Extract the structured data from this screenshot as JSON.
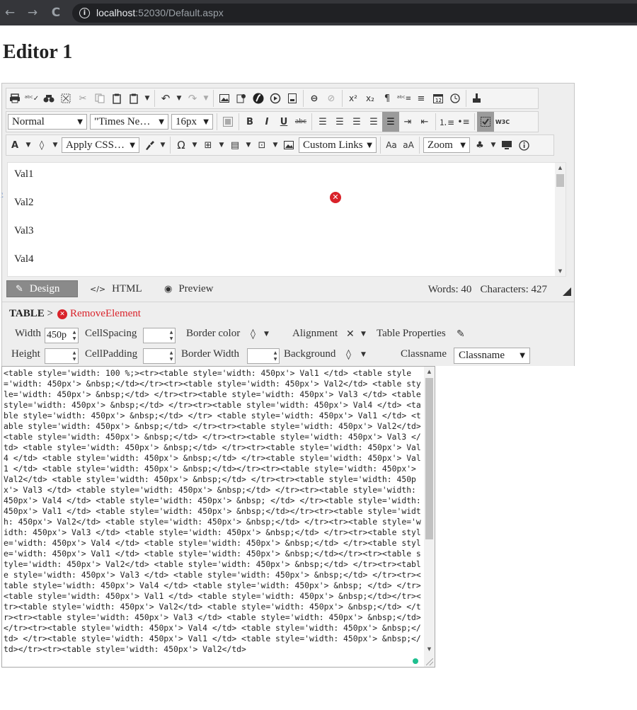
{
  "browser": {
    "back_icon": "←",
    "forward_icon": "→",
    "reload_icon": "C",
    "url_host": "localhost",
    "url_rest": ":52030/Default.aspx"
  },
  "page": {
    "title": "Editor 1"
  },
  "toolbar": {
    "row1": [
      "print-icon",
      "spellcheck-icon",
      "find-icon",
      "select-all-icon",
      "cut-icon",
      "copy-icon",
      "paste-icon",
      "paste-special-icon",
      "undo-icon",
      "redo-icon",
      "insert-image-icon",
      "insert-document-icon",
      "insert-flash-icon",
      "insert-media-icon",
      "insert-template-icon",
      "link-icon",
      "unlink-icon",
      "superscript-icon",
      "subscript-icon",
      "paragraph-icon",
      "special-chars-icon",
      "justify-icon",
      "date-icon",
      "time-icon",
      "format-painter-icon"
    ],
    "superscript_label": "x²",
    "subscript_label": "x₂",
    "paragraph_label": "¶",
    "format_block": "Normal",
    "font_name": "\"Times Ne…",
    "font_size": "16px",
    "bold": "B",
    "italic": "I",
    "underline": "U",
    "strike": "abc",
    "w3c_label": "W3C",
    "forecolor": "A",
    "apply_css": "Apply CSS…",
    "omega": "Ω",
    "custom_links": "Custom Links",
    "case_upper": "Aa",
    "case_lower": "aA",
    "zoom": "Zoom"
  },
  "content": {
    "rows": [
      "Val1",
      "Val2",
      "Val3",
      "Val4"
    ]
  },
  "modes": {
    "design": "Design",
    "html": "HTML",
    "preview": "Preview",
    "words": "Words: 40",
    "characters": "Characters: 427"
  },
  "props": {
    "tag": "TABLE",
    "sep": ">",
    "remove": "RemoveElement",
    "width_label": "Width",
    "width_value": "450p",
    "cellspacing_label": "CellSpacing",
    "border_color_label": "Border color",
    "alignment_label": "Alignment",
    "table_properties_label": "Table Properties",
    "height_label": "Height",
    "cellpadding_label": "CellPadding",
    "border_width_label": "Border Width",
    "background_label": "Background",
    "classname_label": "Classname",
    "classname_value": "Classname"
  },
  "html_source": "<table style='width: 100 %;><tr><table style='width: 450px'> Val1 </td> <table style='width: 450px'> &nbsp;</td></tr><tr><table style='width: 450px'> Val2</td> <table style='width: 450px'> &nbsp;</td> </tr><tr><table style='width: 450px'> Val3 </td> <table style='width: 450px'> &nbsp;</td> </tr><tr><table style='width: 450px'> Val4 </td> <table style='width: 450px'> &nbsp;</td> </tr> <table style='width: 450px'> Val1 </td> <table style='width: 450px'> &nbsp;</td> </tr><tr><table style='width: 450px'> Val2</td> <table style='width: 450px'> &nbsp;</td> </tr><tr><table style='width: 450px'> Val3 </td> <table style='width: 450px'> &nbsp;</td> </tr><tr><table style='width: 450px'> Val4 </td> <table style='width: 450px'> &nbsp;</td> </tr><table style='width: 450px'> Val1 </td> <table style='width: 450px'> &nbsp;</td></tr><tr><table style='width: 450px'> Val2</td> <table style='width: 450px'> &nbsp;</td> </tr><tr><table style='width: 450px'> Val3 </td> <table style='width: 450px'> &nbsp;</td> </tr><tr><table style='width: 450px'> Val4 </td> <table style='width: 450px'> &nbsp; </td> </tr><table style='width: 450px'> Val1 </td> <table style='width: 450px'> &nbsp;</td></tr><tr><table style='width: 450px'> Val2</td> <table style='width: 450px'> &nbsp;</td> </tr><tr><table style='width: 450px'> Val3 </td> <table style='width: 450px'> &nbsp;</td> </tr><tr><table style='width: 450px'> Val4 </td> <table style='width: 450px'> &nbsp;</td> </tr><table style='width: 450px'> Val1 </td> <table style='width: 450px'> &nbsp;</td></tr><tr><table style='width: 450px'> Val2</td> <table style='width: 450px'> &nbsp;</td> </tr><tr><table style='width: 450px'> Val3 </td> <table style='width: 450px'> &nbsp;</td> </tr><tr><table style='width: 450px'> Val4 </td> <table style='width: 450px'> &nbsp; </td> </tr><table style='width: 450px'> Val1 </td> <table style='width: 450px'> &nbsp;</td></tr><tr><table style='width: 450px'> Val2</td> <table style='width: 450px'> &nbsp;</td> </tr><tr><table style='width: 450px'> Val3 </td> <table style='width: 450px'> &nbsp;</td> </tr><tr><table style='width: 450px'> Val4 </td> <table style='width: 450px'> &nbsp;</td> </tr><table style='width: 450px'> Val1 </td> <table style='width: 450px'> &nbsp;</td></tr><tr><table style='width: 450px'> Val2</td>"
}
